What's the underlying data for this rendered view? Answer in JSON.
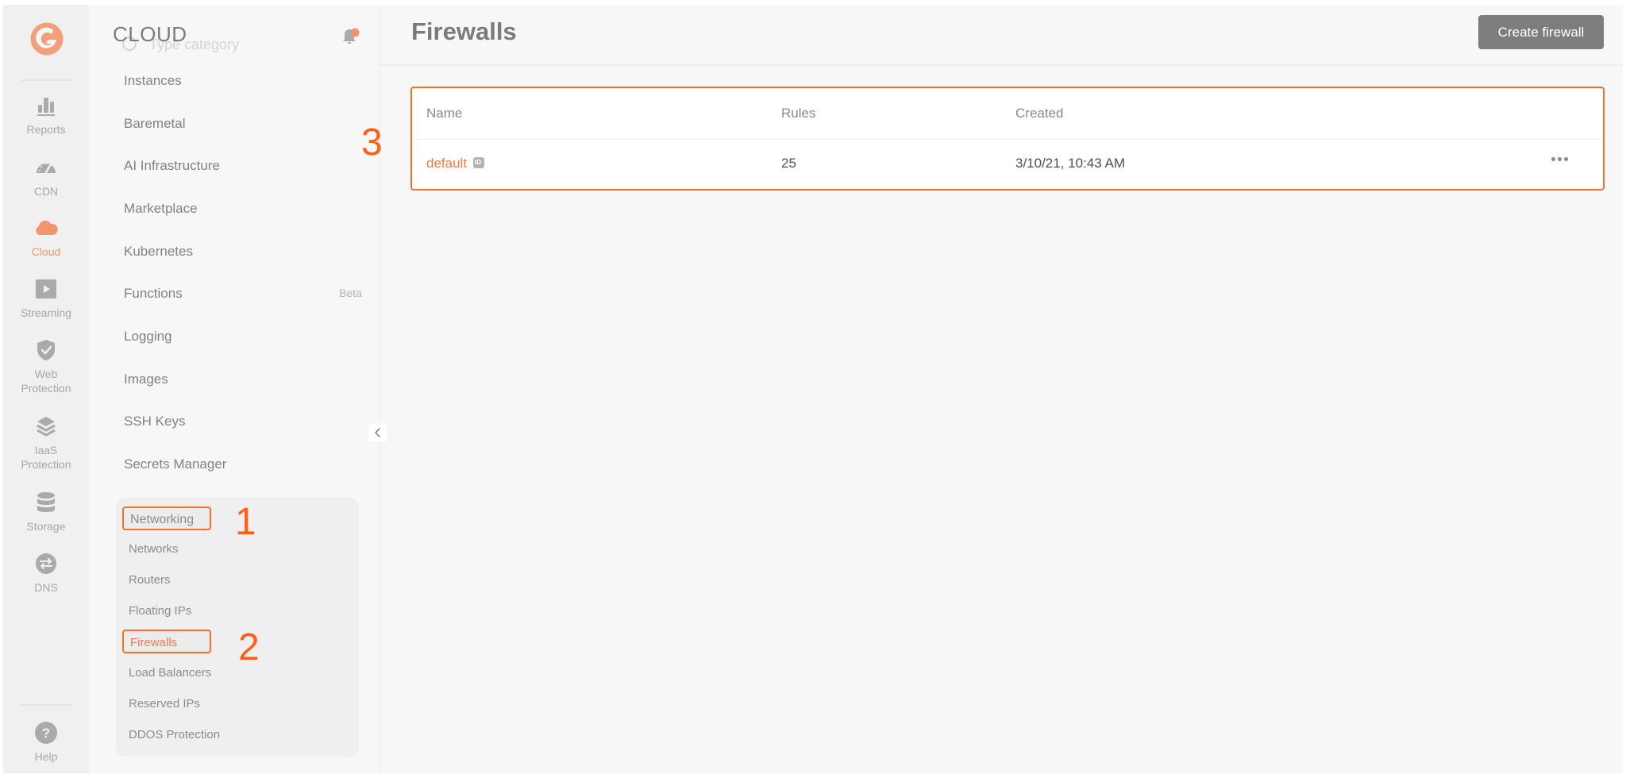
{
  "rail": {
    "logo": "gcore-logo",
    "items": [
      {
        "label": "Reports",
        "icon": "bar-chart-icon",
        "active": false
      },
      {
        "label": "CDN",
        "icon": "speedometer-icon",
        "active": false
      },
      {
        "label": "Cloud",
        "icon": "cloud-icon",
        "active": true
      },
      {
        "label": "Streaming",
        "icon": "play-icon",
        "active": false
      },
      {
        "label": "Web Protection",
        "label_line1": "Web",
        "label_line2": "Protection",
        "icon": "shield-check-icon",
        "active": false
      },
      {
        "label": "IaaS Protection",
        "label_line1": "IaaS",
        "label_line2": "Protection",
        "icon": "layers-icon",
        "active": false
      },
      {
        "label": "Storage",
        "icon": "database-icon",
        "active": false
      },
      {
        "label": "DNS",
        "icon": "swap-arrows-icon",
        "active": false
      }
    ],
    "help": {
      "label": "Help",
      "icon": "question-icon"
    }
  },
  "category": {
    "title": "CLOUD",
    "search_placeholder": "Type category",
    "notification_icon": "bell-icon",
    "menu": [
      {
        "label": "Instances"
      },
      {
        "label": "Baremetal"
      },
      {
        "label": "AI Infrastructure"
      },
      {
        "label": "Marketplace"
      },
      {
        "label": "Kubernetes"
      },
      {
        "label": "Functions",
        "badge": "Beta"
      },
      {
        "label": "Logging"
      },
      {
        "label": "Images"
      },
      {
        "label": "SSH Keys"
      },
      {
        "label": "Secrets Manager"
      }
    ],
    "group": {
      "heading": "Networking",
      "items": [
        {
          "label": "Networks"
        },
        {
          "label": "Routers"
        },
        {
          "label": "Floating IPs"
        },
        {
          "label": "Firewalls",
          "current": true
        },
        {
          "label": "Load Balancers"
        },
        {
          "label": "Reserved IPs"
        },
        {
          "label": "DDOS Protection"
        }
      ]
    }
  },
  "annotations": {
    "one": "1",
    "two": "2",
    "three": "3"
  },
  "page": {
    "title": "Firewalls",
    "create_button": "Create firewall"
  },
  "table": {
    "columns": [
      "Name",
      "Rules",
      "Created"
    ],
    "rows": [
      {
        "name": "default",
        "rules": "25",
        "created": "3/10/21, 10:43 AM"
      }
    ]
  },
  "colors": {
    "accent": "#f07a41",
    "annotation": "#ff5f16",
    "highlight_border": "#f76f2b",
    "button_bg": "#7d7d7d"
  }
}
